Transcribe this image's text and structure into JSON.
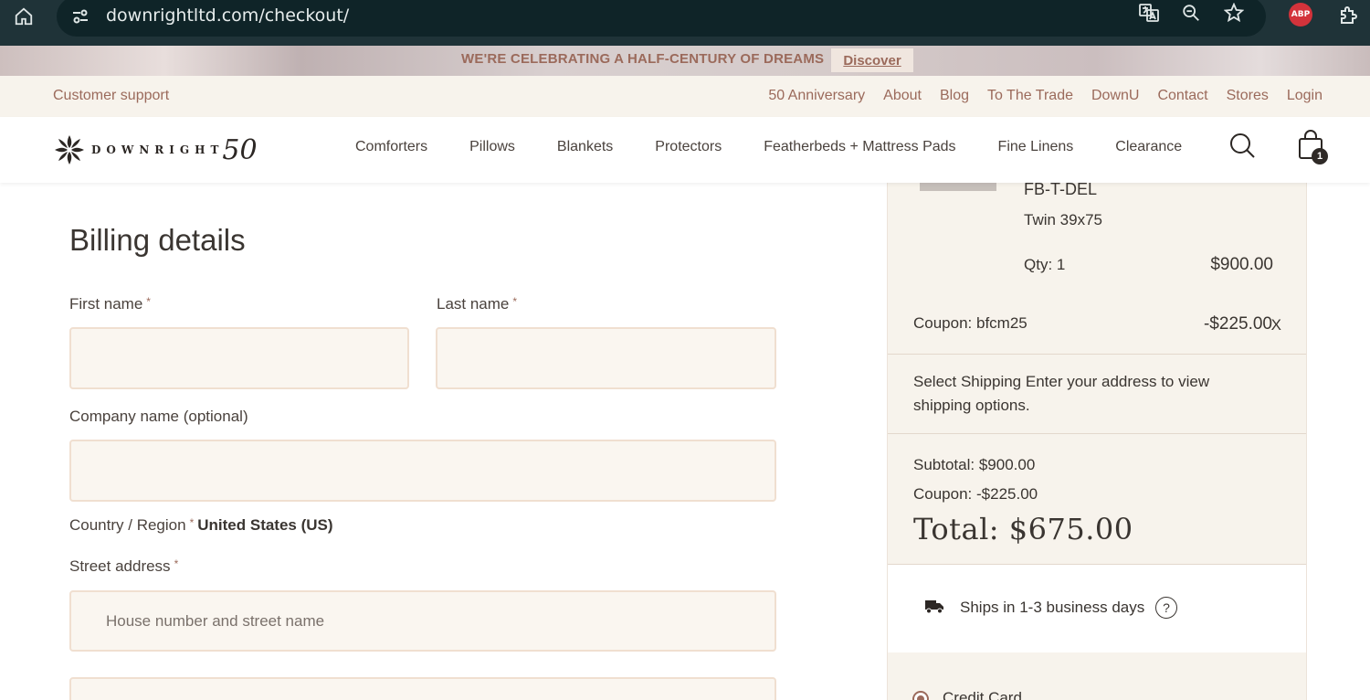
{
  "browser": {
    "url": "downrightltd.com/checkout/",
    "extension_badge": "ABP",
    "icons": [
      "home-icon",
      "site-info-icon",
      "translate-icon",
      "zoom-icon",
      "bookmark-star-icon",
      "extensions-icon"
    ]
  },
  "promo": {
    "text": "WE'RE CELEBRATING A HALF-CENTURY OF DREAMS",
    "link": "Discover"
  },
  "utility": {
    "support": "Customer support",
    "links": [
      "50 Anniversary",
      "About",
      "Blog",
      "To The Trade",
      "DownU",
      "Contact",
      "Stores",
      "Login"
    ]
  },
  "header": {
    "logo_word": "DOWNRIGHT",
    "logo_number": "50",
    "nav": [
      "Comforters",
      "Pillows",
      "Blankets",
      "Protectors",
      "Featherbeds + Mattress Pads",
      "Fine Linens",
      "Clearance"
    ],
    "cart_count": "1"
  },
  "billing": {
    "title": "Billing details",
    "first_name_label": "First name",
    "last_name_label": "Last name",
    "company_label": "Company name (optional)",
    "country_label": "Country / Region",
    "country_value": "United States (US)",
    "street_label": "Street address",
    "street_placeholder": "House number and street name",
    "required_mark": "*"
  },
  "summary": {
    "sku": "FB-T-DEL",
    "variant": "Twin 39x75",
    "qty": "Qty: 1",
    "price": "$900.00",
    "coupon_label": "Coupon: bfcm25",
    "coupon_amount": "-$225.00",
    "coupon_remove": "X",
    "shipping_text": "Select Shipping Enter your address to view shipping options.",
    "subtotal": "Subtotal: $900.00",
    "coupon_total": "Coupon:  -$225.00",
    "total": "Total: $675.00",
    "ships_text": "Ships in 1-3 business days",
    "help": "?",
    "payment_option": "Credit Card"
  },
  "colors": {
    "accent": "#9b6a5b",
    "browser_bg": "#1f3338",
    "cream": "#f7f3ec",
    "input_border": "#f0dfd0"
  }
}
